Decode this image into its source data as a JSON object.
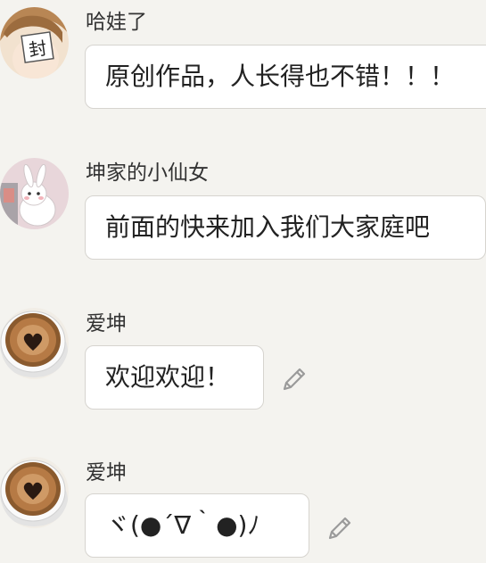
{
  "messages": [
    {
      "sender": "哈娃了",
      "text": "原创作品，人长得也不错！！！",
      "avatar_icon": "anime-boy-avatar-icon",
      "editable": false
    },
    {
      "sender": "坤家的小仙女",
      "text": "前面的快来加入我们大家庭吧",
      "avatar_icon": "bunny-avatar-icon",
      "editable": false
    },
    {
      "sender": "爱坤",
      "text": "欢迎欢迎！",
      "avatar_icon": "coffee-heart-avatar-icon",
      "editable": true
    },
    {
      "sender": "爱坤",
      "text": "ヾ(●´∇｀●)ﾉ",
      "avatar_icon": "coffee-heart-avatar-icon",
      "editable": true
    }
  ],
  "avatar_badge": "封",
  "edit_icon": "pencil-icon",
  "colors": {
    "background": "#f4f3ef",
    "bubble": "#ffffff",
    "bubble_border": "#d6d4cf",
    "icon": "#9a9a9a"
  }
}
